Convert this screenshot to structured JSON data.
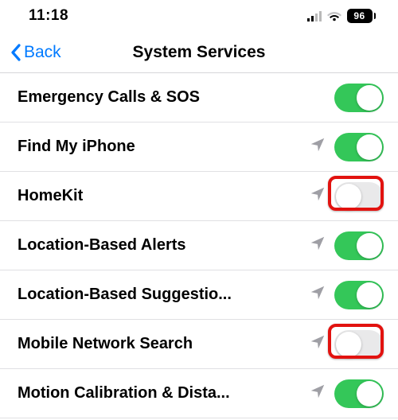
{
  "status": {
    "time": "11:18",
    "battery": "96"
  },
  "nav": {
    "back": "Back",
    "title": "System Services"
  },
  "rows": [
    {
      "label": "Emergency Calls & SOS",
      "loc": false,
      "on": true
    },
    {
      "label": "Find My iPhone",
      "loc": true,
      "on": true
    },
    {
      "label": "HomeKit",
      "loc": true,
      "on": false
    },
    {
      "label": "Location-Based Alerts",
      "loc": true,
      "on": true
    },
    {
      "label": "Location-Based Suggestio...",
      "loc": true,
      "on": true
    },
    {
      "label": "Mobile Network Search",
      "loc": true,
      "on": false
    },
    {
      "label": "Motion Calibration & Dista...",
      "loc": true,
      "on": true
    }
  ],
  "highlights": [
    2,
    5
  ]
}
